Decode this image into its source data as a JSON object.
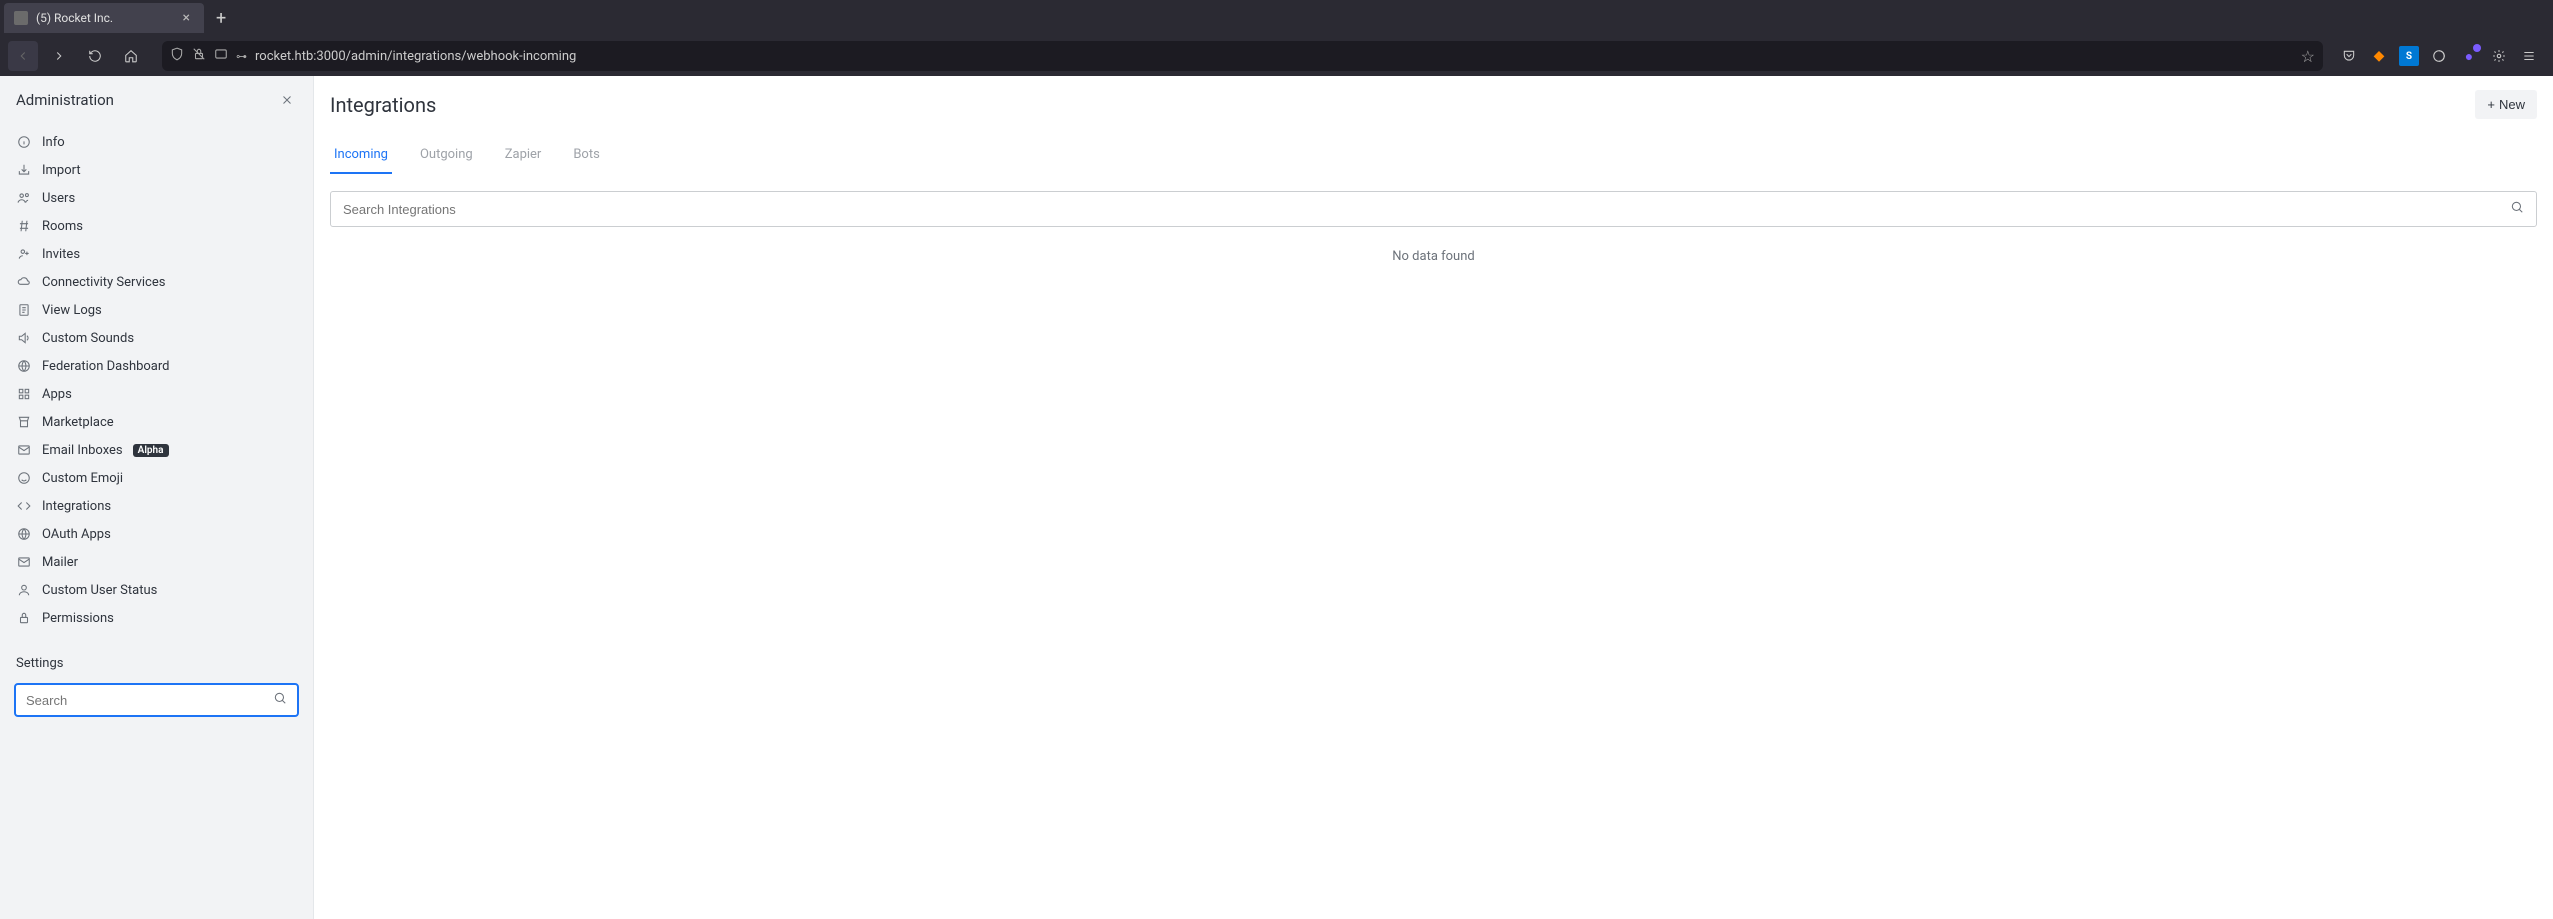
{
  "browser": {
    "tab_title": "(5) Rocket Inc.",
    "url": "rocket.htb:3000/admin/integrations/webhook-incoming"
  },
  "sidebar": {
    "title": "Administration",
    "items": [
      {
        "icon": "info",
        "label": "Info"
      },
      {
        "icon": "import",
        "label": "Import"
      },
      {
        "icon": "users",
        "label": "Users"
      },
      {
        "icon": "hash",
        "label": "Rooms"
      },
      {
        "icon": "invite",
        "label": "Invites"
      },
      {
        "icon": "cloud",
        "label": "Connectivity Services"
      },
      {
        "icon": "logs",
        "label": "View Logs"
      },
      {
        "icon": "sound",
        "label": "Custom Sounds"
      },
      {
        "icon": "globe",
        "label": "Federation Dashboard"
      },
      {
        "icon": "apps",
        "label": "Apps"
      },
      {
        "icon": "market",
        "label": "Marketplace"
      },
      {
        "icon": "mail",
        "label": "Email Inboxes",
        "badge": "Alpha"
      },
      {
        "icon": "emoji",
        "label": "Custom Emoji"
      },
      {
        "icon": "code",
        "label": "Integrations"
      },
      {
        "icon": "globe",
        "label": "OAuth Apps"
      },
      {
        "icon": "mail",
        "label": "Mailer"
      },
      {
        "icon": "user",
        "label": "Custom User Status"
      },
      {
        "icon": "lock",
        "label": "Permissions"
      }
    ],
    "settings_header": "Settings",
    "settings_placeholder": "Search"
  },
  "main": {
    "title": "Integrations",
    "new_button": "New",
    "tabs": [
      {
        "label": "Incoming",
        "active": true
      },
      {
        "label": "Outgoing",
        "active": false
      },
      {
        "label": "Zapier",
        "active": false
      },
      {
        "label": "Bots",
        "active": false
      }
    ],
    "search_placeholder": "Search Integrations",
    "no_data": "No data found"
  }
}
